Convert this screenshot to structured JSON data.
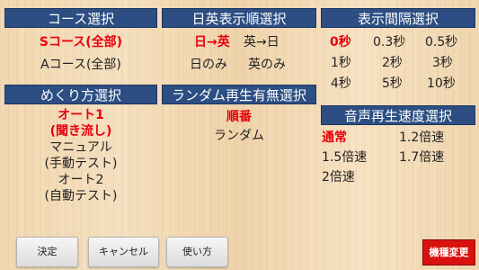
{
  "course": {
    "header": "コース選択",
    "options": [
      "Sコース(全部)",
      "Aコース(全部)"
    ]
  },
  "order": {
    "header": "日英表示順選択",
    "options": [
      "日→英",
      "英→日",
      "日のみ",
      "英のみ"
    ]
  },
  "interval": {
    "header": "表示間隔選択",
    "options": [
      "0秒",
      "0.3秒",
      "0.5秒",
      "1秒",
      "2秒",
      "3秒",
      "4秒",
      "5秒",
      "10秒"
    ]
  },
  "mekuri": {
    "header": "めくり方選択",
    "options": [
      {
        "line1": "オート1",
        "line2": "(聞き流し)"
      },
      {
        "line1": "マニュアル",
        "line2": "(手動テスト)"
      },
      {
        "line1": "オート2",
        "line2": "(自動テスト)"
      }
    ]
  },
  "random": {
    "header": "ランダム再生有無選択",
    "options": [
      "順番",
      "ランダム"
    ]
  },
  "speed": {
    "header": "音声再生速度選択",
    "options": [
      "通常",
      "1.2倍速",
      "1.5倍速",
      "1.7倍速",
      "2倍速"
    ]
  },
  "buttons": {
    "ok": "決定",
    "cancel": "キャンセル",
    "howto": "使い方",
    "change_device": "機種変更"
  }
}
